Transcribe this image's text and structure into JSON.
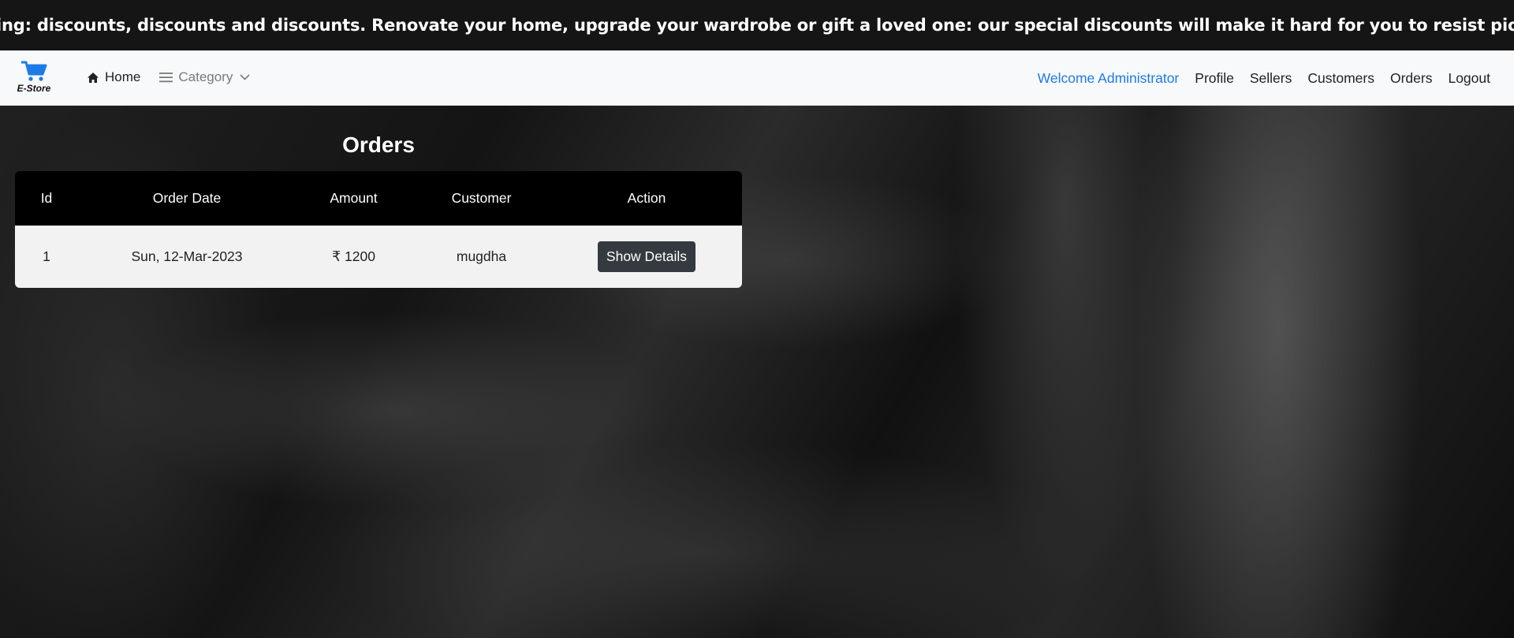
{
  "banner": {
    "text": "ing: discounts, discounts and discounts. Renovate your home, upgrade your wardrobe or gift a loved one: our special discounts will make it hard for you to resist picking more than just one p"
  },
  "navbar": {
    "brand_label": "E-Store",
    "brand_icon": "cart-icon",
    "home_label": "Home",
    "category_label": "Category",
    "welcome_text": "Welcome Administrator",
    "profile_label": "Profile",
    "sellers_label": "Sellers",
    "customers_label": "Customers",
    "orders_label": "Orders",
    "logout_label": "Logout",
    "accent_color": "#1e7be6"
  },
  "orders": {
    "title": "Orders",
    "columns": [
      "Id",
      "Order Date",
      "Amount",
      "Customer",
      "Action"
    ],
    "rows": [
      {
        "id": "1",
        "date": "Sun, 12-Mar-2023",
        "amount": "₹ 1200",
        "customer": "mugdha",
        "action_label": "Show Details"
      }
    ]
  }
}
